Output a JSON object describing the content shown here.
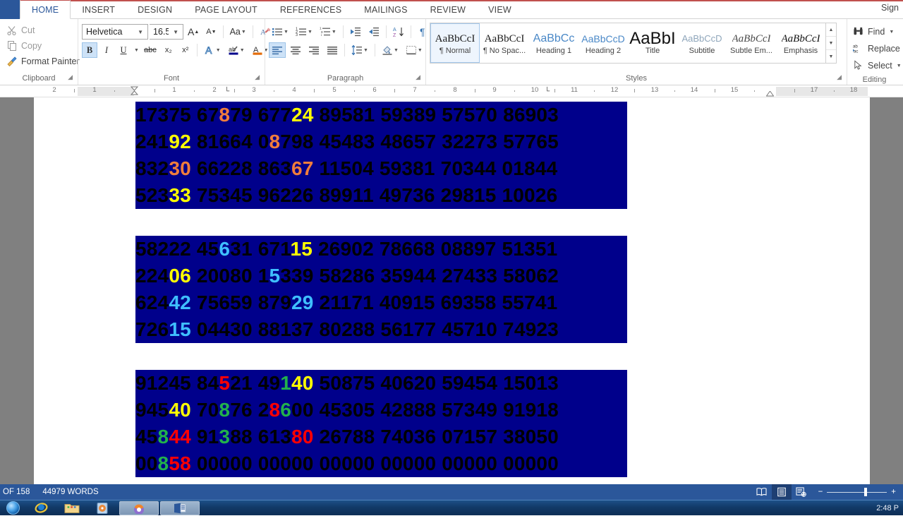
{
  "window": {
    "sign_in": "Sign",
    "tabs": [
      {
        "label": "HOME",
        "active": true
      },
      {
        "label": "INSERT",
        "active": false
      },
      {
        "label": "DESIGN",
        "active": false
      },
      {
        "label": "PAGE LAYOUT",
        "active": false
      },
      {
        "label": "REFERENCES",
        "active": false
      },
      {
        "label": "MAILINGS",
        "active": false
      },
      {
        "label": "REVIEW",
        "active": false
      },
      {
        "label": "VIEW",
        "active": false
      }
    ]
  },
  "ribbon": {
    "clipboard": {
      "label": "Clipboard",
      "items": [
        {
          "label": "Cut",
          "icon": "scissors-icon",
          "enabled": false
        },
        {
          "label": "Copy",
          "icon": "copy-icon",
          "enabled": false
        },
        {
          "label": "Format Painter",
          "icon": "format-painter-icon",
          "enabled": true
        }
      ]
    },
    "font": {
      "label": "Font",
      "font_name": "Helvetica",
      "font_size": "16.5",
      "grow_font": "A",
      "shrink_font": "A",
      "change_case": "Aa",
      "clear_formatting": "clear-formatting-icon",
      "bold": "B",
      "italic": "I",
      "underline": "U",
      "strikethrough": "abc",
      "subscript": "x₂",
      "superscript": "x²",
      "text_effects": "A",
      "highlight": "highlight-icon",
      "font_color": "A"
    },
    "paragraph": {
      "label": "Paragraph",
      "bullets": "bullets-icon",
      "numbering": "numbering-icon",
      "multilevel": "multilevel-list-icon",
      "decrease_indent": "decrease-indent-icon",
      "increase_indent": "increase-indent-icon",
      "sort": "sort-icon",
      "show_marks": "¶",
      "align_left": "align-left-icon",
      "align_center": "align-center-icon",
      "align_right": "align-right-icon",
      "justify": "justify-icon",
      "line_spacing": "line-spacing-icon",
      "shading": "shading-icon",
      "borders": "borders-icon"
    },
    "styles": {
      "label": "Styles",
      "items": [
        {
          "preview": "AaBbCcI",
          "name": "¶ Normal",
          "selected": true,
          "style": "normal"
        },
        {
          "preview": "AaBbCcI",
          "name": "¶ No Spac...",
          "selected": false,
          "style": "normal"
        },
        {
          "preview": "AaBbCc",
          "name": "Heading 1",
          "selected": false,
          "style": "heading"
        },
        {
          "preview": "AaBbCcD",
          "name": "Heading 2",
          "selected": false,
          "style": "heading"
        },
        {
          "preview": "AaBbI",
          "name": "Title",
          "selected": false,
          "style": "title"
        },
        {
          "preview": "AaBbCcD",
          "name": "Subtitle",
          "selected": false,
          "style": "subtle"
        },
        {
          "preview": "AaBbCcI",
          "name": "Subtle Em...",
          "selected": false,
          "style": "italic"
        },
        {
          "preview": "AaBbCcI",
          "name": "Emphasis",
          "selected": false,
          "style": "italic"
        }
      ]
    },
    "editing": {
      "label": "Editing",
      "items": [
        {
          "label": "Find",
          "icon": "binoculars-icon",
          "caret": true
        },
        {
          "label": "Replace",
          "icon": "replace-icon",
          "caret": false
        },
        {
          "label": "Select",
          "icon": "select-cursor-icon",
          "caret": true
        }
      ]
    }
  },
  "ruler": {
    "labels_left": [
      "2",
      "1"
    ],
    "labels_right": [
      "1",
      "2",
      "3",
      "4",
      "5",
      "6",
      "7",
      "8",
      "9",
      "10",
      "11",
      "12",
      "13",
      "14",
      "15",
      "17",
      "18"
    ]
  },
  "document": {
    "highlight_color": "#00008B",
    "text_color": "#000000",
    "blocks": [
      {
        "lines": [
          [
            {
              "t": "17375 67",
              "c": "black"
            },
            {
              "t": "8",
              "c": "orange"
            },
            {
              "t": "79 677",
              "c": "black"
            },
            {
              "t": "24",
              "c": "yellow"
            },
            {
              "t": " 89581 59389 57570 86903",
              "c": "black"
            }
          ],
          [
            {
              "t": "241",
              "c": "black"
            },
            {
              "t": "92",
              "c": "yellow"
            },
            {
              "t": " 81664 0",
              "c": "black"
            },
            {
              "t": "8",
              "c": "orange"
            },
            {
              "t": "798 45483 48657 32273 57765",
              "c": "black"
            }
          ],
          [
            {
              "t": "832",
              "c": "black"
            },
            {
              "t": "30",
              "c": "orange"
            },
            {
              "t": " 66228 863",
              "c": "black"
            },
            {
              "t": "67",
              "c": "orange"
            },
            {
              "t": " 11504 59381 70344 01844",
              "c": "black"
            }
          ],
          [
            {
              "t": "523",
              "c": "black"
            },
            {
              "t": "33",
              "c": "yellow"
            },
            {
              "t": " 75345 96226 89911 49736 29815 10026",
              "c": "black"
            }
          ]
        ]
      },
      {
        "lines": [
          [
            {
              "t": "58222 45",
              "c": "black"
            },
            {
              "t": "6",
              "c": "cyan"
            },
            {
              "t": "31 671",
              "c": "black"
            },
            {
              "t": "15",
              "c": "yellow"
            },
            {
              "t": " 26902 78668 08897 51351",
              "c": "black"
            }
          ],
          [
            {
              "t": "224",
              "c": "black"
            },
            {
              "t": "06",
              "c": "yellow"
            },
            {
              "t": " 20080 1",
              "c": "black"
            },
            {
              "t": "5",
              "c": "cyan"
            },
            {
              "t": "339 58286 35944 27433 58062",
              "c": "black"
            }
          ],
          [
            {
              "t": "624",
              "c": "black"
            },
            {
              "t": "42",
              "c": "cyan"
            },
            {
              "t": " 75659 879",
              "c": "black"
            },
            {
              "t": "29",
              "c": "cyan"
            },
            {
              "t": " 21171 40915 69358 55741",
              "c": "black"
            }
          ],
          [
            {
              "t": "726",
              "c": "black"
            },
            {
              "t": "15",
              "c": "cyan"
            },
            {
              "t": " 04430 88137 80288 56177 45710 74923",
              "c": "black"
            }
          ]
        ]
      },
      {
        "lines": [
          [
            {
              "t": "91245 84",
              "c": "black"
            },
            {
              "t": "5",
              "c": "red"
            },
            {
              "t": "21 49",
              "c": "black"
            },
            {
              "t": "1",
              "c": "green"
            },
            {
              "t": "40",
              "c": "yellow"
            },
            {
              "t": " 50875 40620 59454 15013",
              "c": "black"
            }
          ],
          [
            {
              "t": "945",
              "c": "black"
            },
            {
              "t": "40",
              "c": "yellow"
            },
            {
              "t": " 70",
              "c": "black"
            },
            {
              "t": "8",
              "c": "green"
            },
            {
              "t": "76 2",
              "c": "black"
            },
            {
              "t": "8",
              "c": "red"
            },
            {
              "t": "6",
              "c": "green"
            },
            {
              "t": "00 45305 42888 57349 91918",
              "c": "black"
            }
          ],
          [
            {
              "t": "45",
              "c": "black"
            },
            {
              "t": "8",
              "c": "green"
            },
            {
              "t": "44",
              "c": "red"
            },
            {
              "t": " 91",
              "c": "black"
            },
            {
              "t": "3",
              "c": "green"
            },
            {
              "t": "88 613",
              "c": "black"
            },
            {
              "t": "80",
              "c": "red"
            },
            {
              "t": " 26788 74036 07157 38050",
              "c": "black"
            }
          ],
          [
            {
              "t": "00",
              "c": "black"
            },
            {
              "t": "8",
              "c": "green"
            },
            {
              "t": "58",
              "c": "red"
            },
            {
              "t": " 00000 00000 00000 00000 00000 00000",
              "c": "black"
            }
          ]
        ]
      }
    ],
    "digit_colors": {
      "black": "#000000",
      "yellow": "#FFFF00",
      "orange": "#F07D3C",
      "cyan": "#3FBFFF",
      "red": "#FF0000",
      "green": "#22B14C"
    }
  },
  "statusbar": {
    "page_of": "OF 158",
    "word_count": "44979 WORDS",
    "views": [
      {
        "name": "read-mode-icon",
        "selected": false
      },
      {
        "name": "print-layout-icon",
        "selected": true
      },
      {
        "name": "web-layout-icon",
        "selected": false
      }
    ],
    "zoom_out": "−",
    "zoom_in": "+",
    "zoom_level": ""
  },
  "taskbar": {
    "start": "start-orb-icon",
    "items": [
      {
        "name": "internet-explorer-icon"
      },
      {
        "name": "file-explorer-icon"
      },
      {
        "name": "media-player-icon"
      },
      {
        "name": "chrome-window-icon"
      },
      {
        "name": "word-window-icon"
      }
    ],
    "clock": "2:48 P"
  }
}
